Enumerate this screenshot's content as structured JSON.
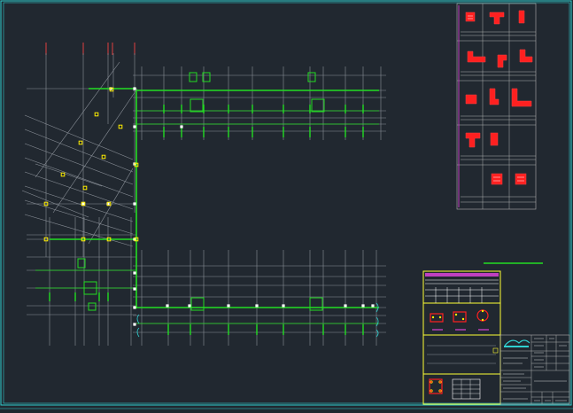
{
  "drawing": {
    "background": "#212830",
    "colors": {
      "frame": "#2fd0d0",
      "grid": "#8a9098",
      "wall": "#22dd22",
      "column": "#ffffff",
      "node": "#ffee00",
      "detail": "#ff2020",
      "axis_tick": "#e04040",
      "title_block": "#ffff33",
      "hatch": "#c040c0",
      "table_line": "#b0b0b0"
    },
    "icons": [
      "cad-logo-icon"
    ]
  }
}
